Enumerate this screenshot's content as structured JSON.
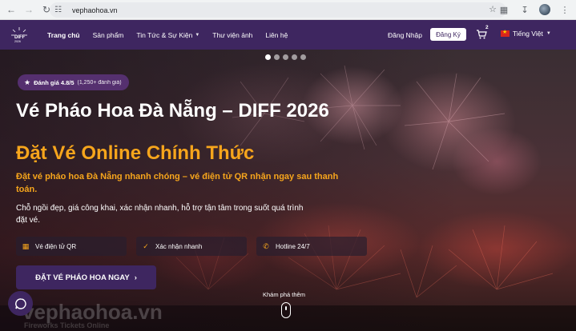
{
  "browser": {
    "url": "vephaohoa.vn",
    "icons": [
      "back-icon",
      "forward-icon",
      "reload-icon",
      "site-settings-icon",
      "bookmark-star-icon",
      "extensions-icon",
      "download-icon",
      "profile-avatar",
      "more-menu-icon"
    ]
  },
  "header": {
    "menu": [
      {
        "label": "Trang chủ",
        "active": true,
        "dropdown": false
      },
      {
        "label": "Sản phẩm",
        "active": false,
        "dropdown": false
      },
      {
        "label": "Tin Tức & Sự Kiện",
        "active": false,
        "dropdown": true
      },
      {
        "label": "Thư viện ảnh",
        "active": false,
        "dropdown": false
      },
      {
        "label": "Liên hệ",
        "active": false,
        "dropdown": false
      }
    ],
    "login_label": "Đăng Nhập",
    "register_label": "Đăng Ký",
    "cart_count": "2",
    "language_label": "Tiếng Việt"
  },
  "hero": {
    "slide_count": 5,
    "active_slide": 1,
    "rating_label": "Đánh giá 4.8/5",
    "rating_count": "(1,250+ đánh giá)",
    "title_line1": "Vé Pháo Hoa Đà Nẵng – DIFF 2026",
    "title_line2": "Đặt Vé Online Chính Thức",
    "subtitle": "Đặt vé pháo hoa Đà Nẵng nhanh chóng – vé điện tử QR nhận ngay sau thanh toán.",
    "description": "Chỗ ngồi đẹp, giá công khai, xác nhận nhanh, hỗ trợ tận tâm trong suốt quá trình đặt vé.",
    "features": [
      {
        "label": "Vé điện tử QR",
        "icon": "qr-icon"
      },
      {
        "label": "Xác nhận nhanh",
        "icon": "check-circle-icon"
      },
      {
        "label": "Hotline 24/7",
        "icon": "phone-icon"
      }
    ],
    "cta_label": "ĐẶT VÉ PHÁO HOA NGAY",
    "explore_label": "Khám phá thêm",
    "watermark": "vephaohoa.vn",
    "watermark_sub": "Fireworks Tickets Online"
  },
  "colors": {
    "brand": "#3e2660",
    "accent": "#f6a51c"
  }
}
